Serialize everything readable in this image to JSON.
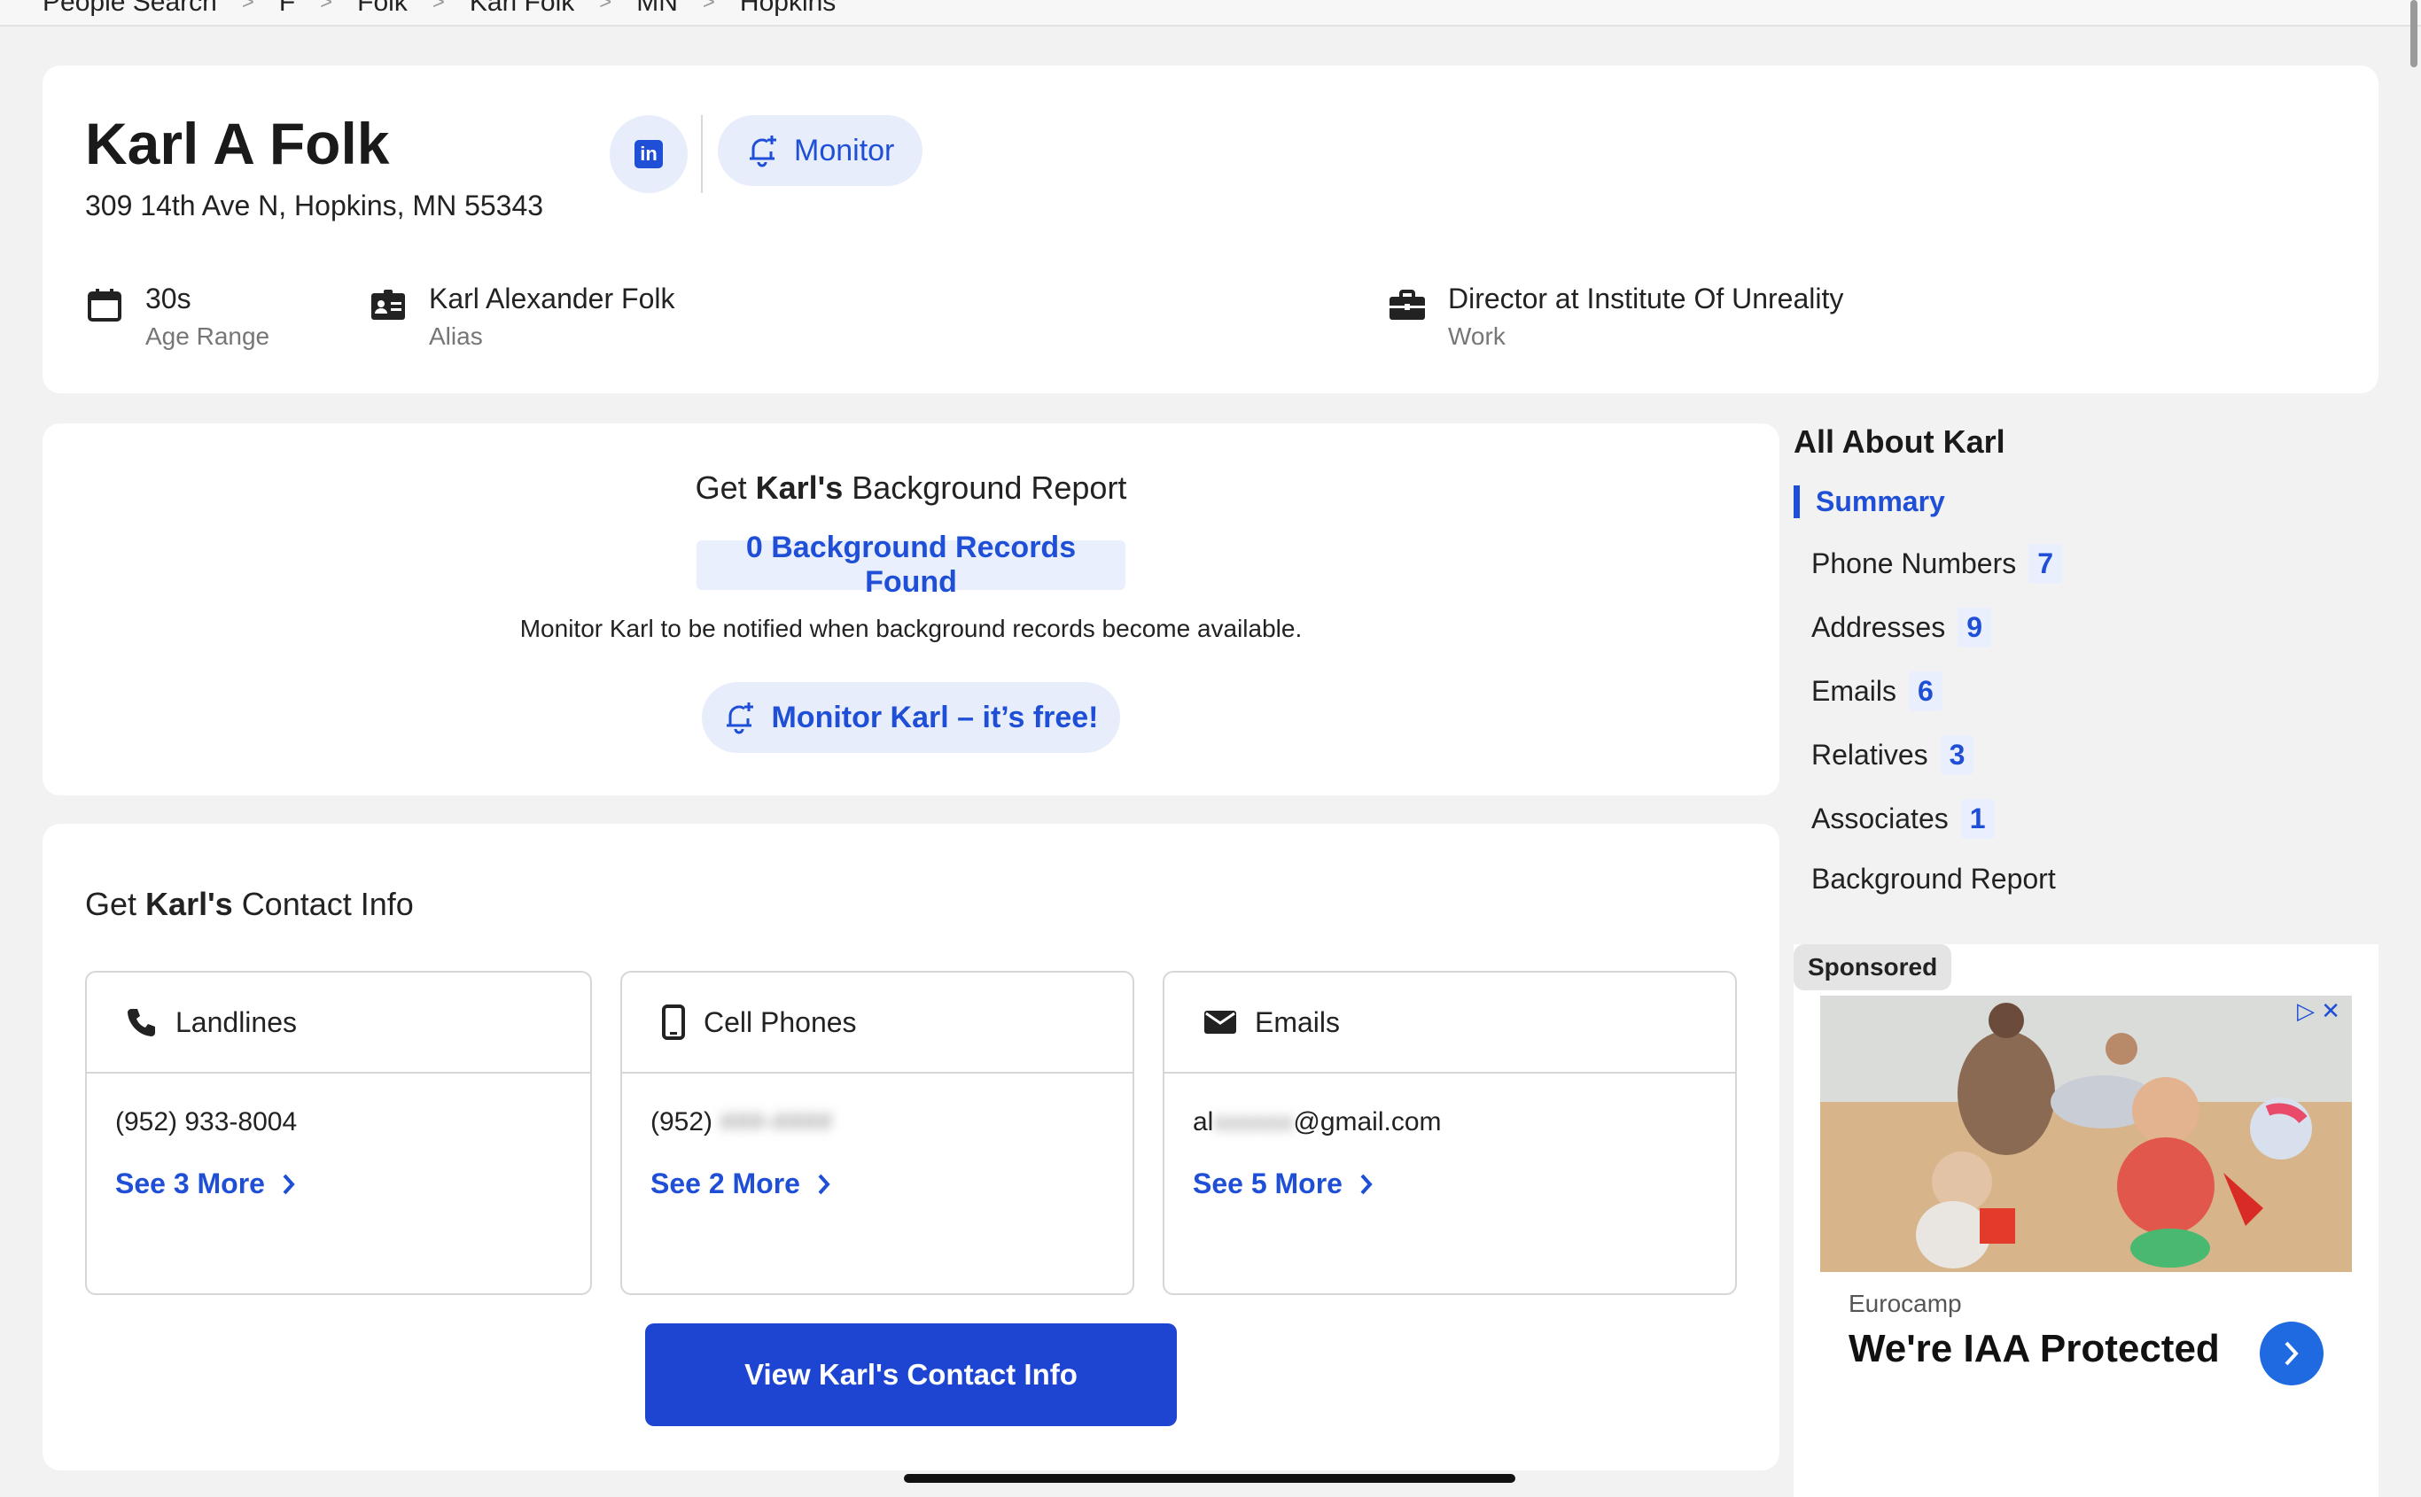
{
  "breadcrumb": [
    "People Search",
    "F",
    "Folk",
    "Karl Folk",
    "MN",
    "Hopkins"
  ],
  "profile": {
    "name": "Karl A Folk",
    "address": "309 14th Ave N, Hopkins, MN 55343",
    "linkedin_label": "in",
    "monitor_label": "Monitor",
    "facts": [
      {
        "value": "30s",
        "label": "Age Range",
        "icon": "calendar-icon"
      },
      {
        "value": "Karl Alexander Folk",
        "label": "Alias",
        "icon": "id-card-icon"
      },
      {
        "value": "Director at Institute Of Unreality",
        "label": "Work",
        "icon": "briefcase-icon"
      }
    ]
  },
  "report": {
    "title_prefix": "Get",
    "title_name": "Karl's",
    "title_suffix": "Background Report",
    "records_found": "0 Background Records Found",
    "note": "Monitor Karl to be notified when background records become available.",
    "monitor_free_label": "Monitor Karl – it’s free!"
  },
  "contact": {
    "title_prefix": "Get",
    "title_name": "Karl's",
    "title_suffix": "Contact Info",
    "boxes": [
      {
        "title": "Landlines",
        "value_visible": "(952) 933-8004",
        "value_hidden": "",
        "value_tail": "",
        "see_more": "See 3 More"
      },
      {
        "title": "Cell Phones",
        "value_visible": "(952)",
        "value_hidden": "###-####",
        "value_tail": "",
        "see_more": "See 2 More"
      },
      {
        "title": "Emails",
        "value_visible": "al",
        "value_hidden": "xxxxxx",
        "value_tail": "@gmail.com",
        "see_more": "See 5 More"
      }
    ],
    "view_button": "View Karl's Contact Info"
  },
  "side": {
    "title": "All About Karl",
    "items": [
      {
        "label": "Summary",
        "count": ""
      },
      {
        "label": "Phone Numbers",
        "count": "7"
      },
      {
        "label": "Addresses",
        "count": "9"
      },
      {
        "label": "Emails",
        "count": "6"
      },
      {
        "label": "Relatives",
        "count": "3"
      },
      {
        "label": "Associates",
        "count": "1"
      },
      {
        "label": "Background Report",
        "count": ""
      }
    ]
  },
  "ad": {
    "sponsored": "Sponsored",
    "brand": "Eurocamp",
    "headline": "We're IAA Protected"
  },
  "colors": {
    "accent": "#1e4fd6",
    "button": "#1e45d1",
    "pill_bg": "#e9effd"
  }
}
